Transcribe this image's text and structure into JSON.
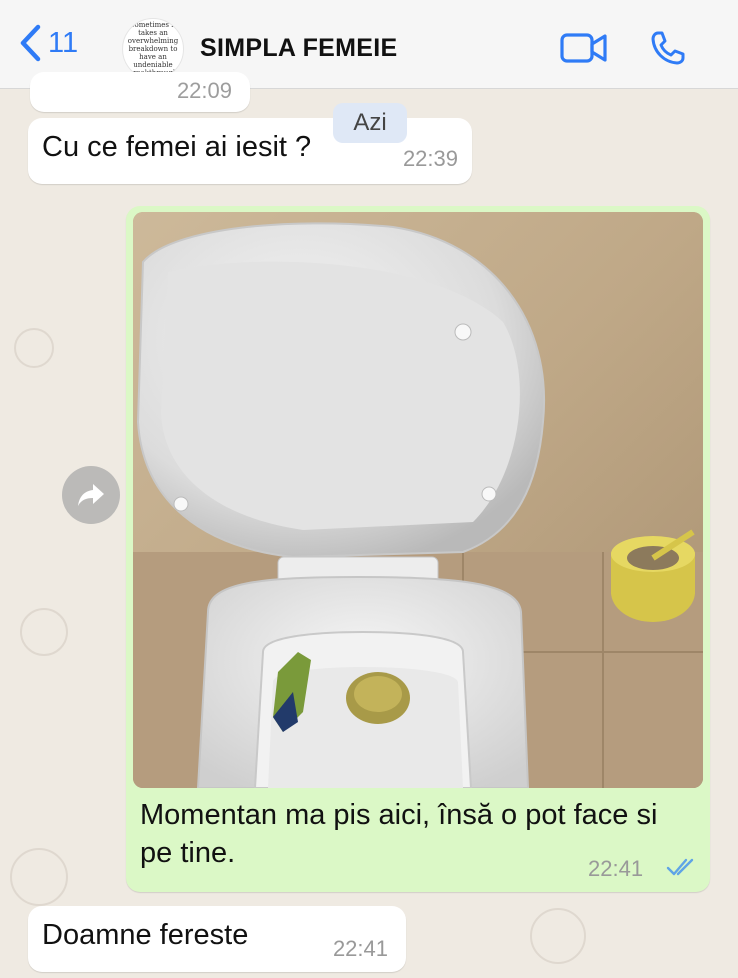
{
  "header": {
    "back_count": "11",
    "contact_name": "SIMPLA FEMEIE",
    "avatar_text": "Sometimes it takes an overwhelming breakdown to have an undeniable breakthrough"
  },
  "date_badge": "Azi",
  "messages": [
    {
      "direction": "in",
      "text": "",
      "time": "22:09"
    },
    {
      "direction": "in",
      "text": "Cu ce femei ai iesit ?",
      "time": "22:39"
    },
    {
      "direction": "out",
      "caption": "Momentan ma pis aici, însă o pot face si pe tine.",
      "time": "22:41",
      "status": "read"
    },
    {
      "direction": "in",
      "text": "Doamne fereste",
      "time": "22:41"
    }
  ],
  "icons": {
    "back": "chevron-left-icon",
    "video": "video-camera-icon",
    "phone": "phone-icon",
    "forward": "forward-arrow-icon",
    "ticks": "double-check-icon"
  },
  "colors": {
    "accent": "#2f7bf6",
    "outgoing_bubble": "#dbf8c6",
    "incoming_bubble": "#ffffff",
    "read_ticks": "#5fa4e6"
  }
}
